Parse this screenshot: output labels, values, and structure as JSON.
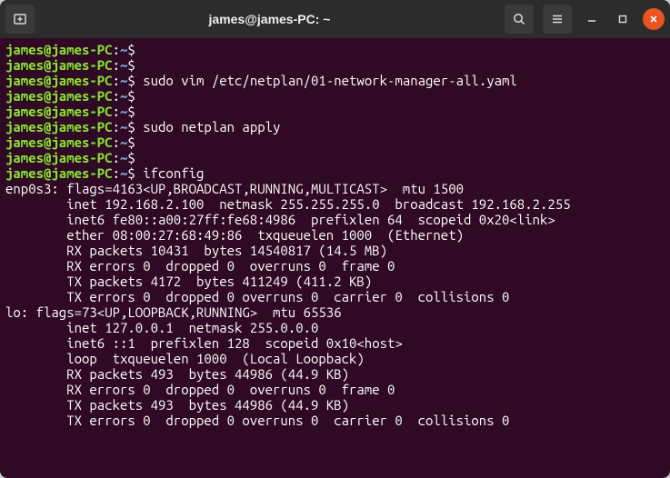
{
  "titlebar": {
    "title": "james@james-PC: ~"
  },
  "prompt": {
    "user_host": "james@james-PC",
    "sep": ":",
    "path": "~",
    "dollar": "$"
  },
  "lines": [
    {
      "type": "prompt",
      "cmd": ""
    },
    {
      "type": "prompt",
      "cmd": ""
    },
    {
      "type": "prompt",
      "cmd": "sudo vim /etc/netplan/01-network-manager-all.yaml"
    },
    {
      "type": "prompt",
      "cmd": ""
    },
    {
      "type": "prompt",
      "cmd": ""
    },
    {
      "type": "prompt",
      "cmd": "sudo netplan apply"
    },
    {
      "type": "prompt",
      "cmd": ""
    },
    {
      "type": "prompt",
      "cmd": ""
    },
    {
      "type": "prompt",
      "cmd": "ifconfig"
    },
    {
      "type": "out",
      "text": "enp0s3: flags=4163<UP,BROADCAST,RUNNING,MULTICAST>  mtu 1500"
    },
    {
      "type": "out",
      "text": "        inet 192.168.2.100  netmask 255.255.255.0  broadcast 192.168.2.255"
    },
    {
      "type": "out",
      "text": "        inet6 fe80::a00:27ff:fe68:4986  prefixlen 64  scopeid 0x20<link>"
    },
    {
      "type": "out",
      "text": "        ether 08:00:27:68:49:86  txqueuelen 1000  (Ethernet)"
    },
    {
      "type": "out",
      "text": "        RX packets 10431  bytes 14540817 (14.5 MB)"
    },
    {
      "type": "out",
      "text": "        RX errors 0  dropped 0  overruns 0  frame 0"
    },
    {
      "type": "out",
      "text": "        TX packets 4172  bytes 411249 (411.2 KB)"
    },
    {
      "type": "out",
      "text": "        TX errors 0  dropped 0 overruns 0  carrier 0  collisions 0"
    },
    {
      "type": "out",
      "text": ""
    },
    {
      "type": "out",
      "text": "lo: flags=73<UP,LOOPBACK,RUNNING>  mtu 65536"
    },
    {
      "type": "out",
      "text": "        inet 127.0.0.1  netmask 255.0.0.0"
    },
    {
      "type": "out",
      "text": "        inet6 ::1  prefixlen 128  scopeid 0x10<host>"
    },
    {
      "type": "out",
      "text": "        loop  txqueuelen 1000  (Local Loopback)"
    },
    {
      "type": "out",
      "text": "        RX packets 493  bytes 44986 (44.9 KB)"
    },
    {
      "type": "out",
      "text": "        RX errors 0  dropped 0  overruns 0  frame 0"
    },
    {
      "type": "out",
      "text": "        TX packets 493  bytes 44986 (44.9 KB)"
    },
    {
      "type": "out",
      "text": "        TX errors 0  dropped 0 overruns 0  carrier 0  collisions 0"
    }
  ]
}
